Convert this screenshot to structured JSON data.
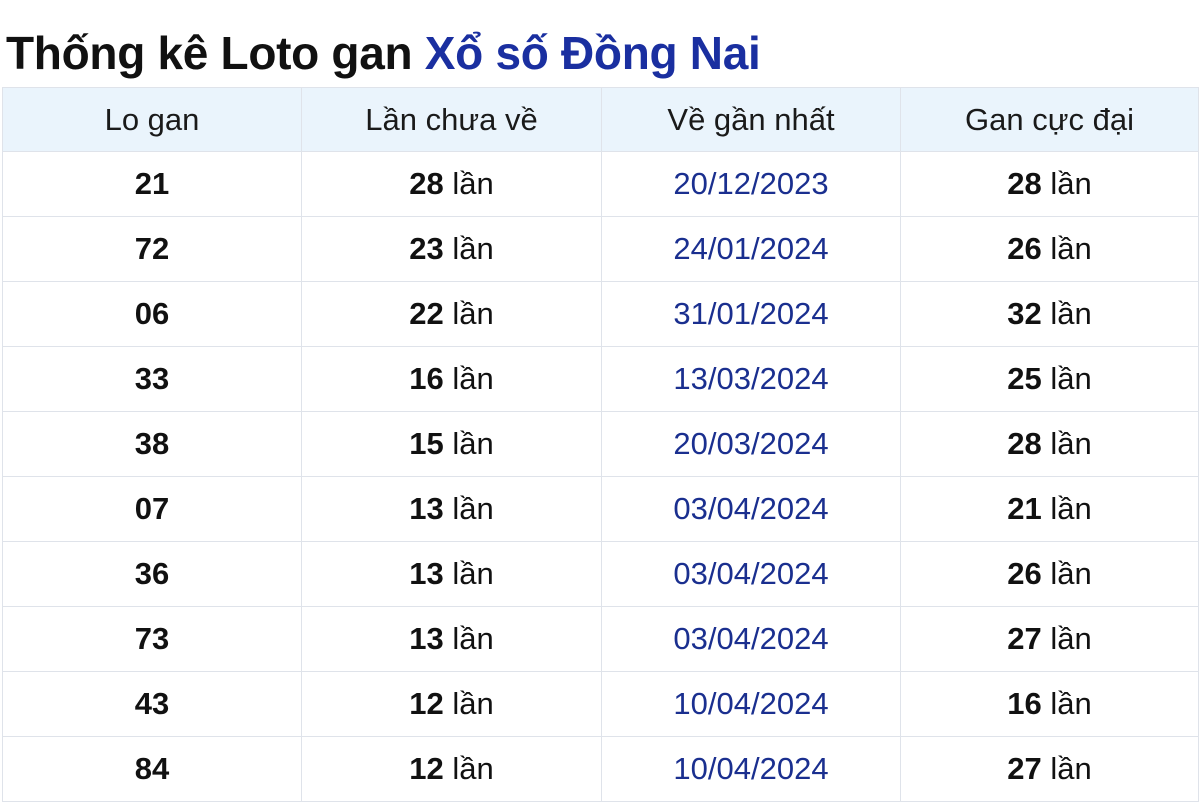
{
  "title": {
    "prefix": "Thống kê Loto gan",
    "highlight": "Xổ số Đồng Nai"
  },
  "unit": "lần",
  "columns": [
    "Lo gan",
    "Lần chưa về",
    "Về gần nhất",
    "Gan cực đại"
  ],
  "rows": [
    {
      "number": "21",
      "missed": "28",
      "last_seen": "20/12/2023",
      "max_gap": "28"
    },
    {
      "number": "72",
      "missed": "23",
      "last_seen": "24/01/2024",
      "max_gap": "26"
    },
    {
      "number": "06",
      "missed": "22",
      "last_seen": "31/01/2024",
      "max_gap": "32"
    },
    {
      "number": "33",
      "missed": "16",
      "last_seen": "13/03/2024",
      "max_gap": "25"
    },
    {
      "number": "38",
      "missed": "15",
      "last_seen": "20/03/2024",
      "max_gap": "28"
    },
    {
      "number": "07",
      "missed": "13",
      "last_seen": "03/04/2024",
      "max_gap": "21"
    },
    {
      "number": "36",
      "missed": "13",
      "last_seen": "03/04/2024",
      "max_gap": "26"
    },
    {
      "number": "73",
      "missed": "13",
      "last_seen": "03/04/2024",
      "max_gap": "27"
    },
    {
      "number": "43",
      "missed": "12",
      "last_seen": "10/04/2024",
      "max_gap": "16"
    },
    {
      "number": "84",
      "missed": "12",
      "last_seen": "10/04/2024",
      "max_gap": "27"
    }
  ],
  "colors": {
    "accent": "#1a2fa0",
    "header_bg": "#eaf4fc",
    "border": "#dfe3ea",
    "date_text": "#1a2f8f"
  }
}
